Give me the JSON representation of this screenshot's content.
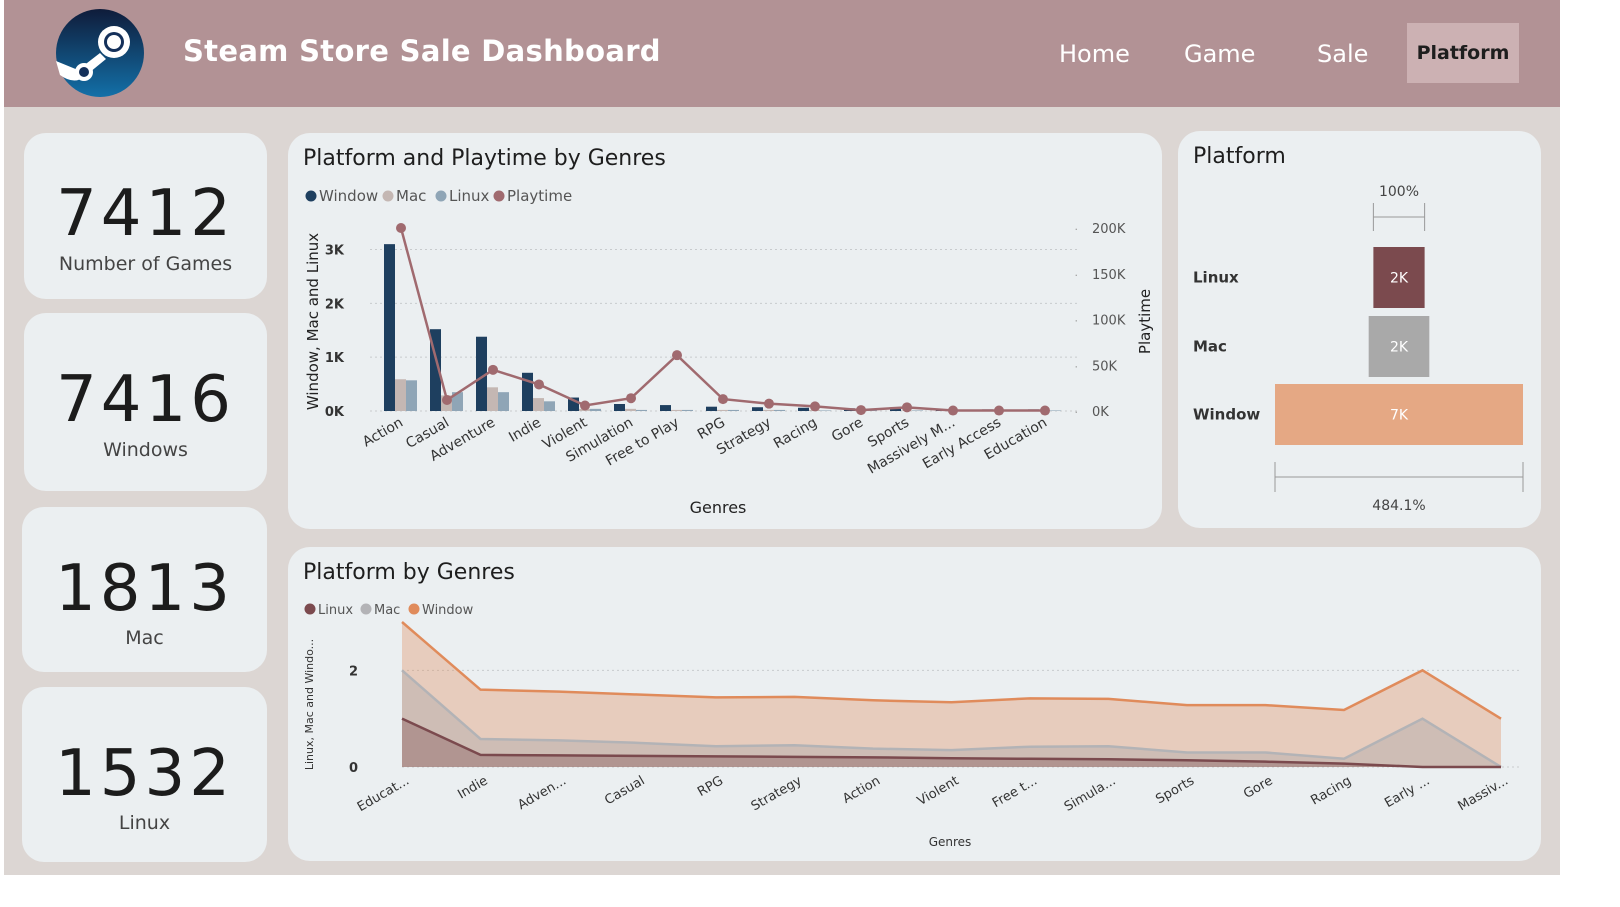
{
  "header": {
    "title": "Steam Store Sale Dashboard",
    "logo_icon": "steam-logo-icon",
    "nav": [
      {
        "label": "Home",
        "active": false
      },
      {
        "label": "Game",
        "active": false
      },
      {
        "label": "Sale",
        "active": false
      },
      {
        "label": "Platform",
        "active": true
      }
    ]
  },
  "kpis": [
    {
      "value": "7412",
      "label": "Number of Games"
    },
    {
      "value": "7416",
      "label": "Windows"
    },
    {
      "value": "1813",
      "label": "Mac"
    },
    {
      "value": "1532",
      "label": "Linux"
    }
  ],
  "colors": {
    "window_bar": "#1e3f5f",
    "mac_bar": "#c4b7b3",
    "linux_bar": "#8fa5b6",
    "playtime_line": "#a06a6f",
    "funnel_linux": "#7b4a4e",
    "funnel_mac": "#a9a9a9",
    "funnel_window": "#e5a884",
    "area_linux": "#7b4a4e",
    "area_mac": "#b3b3b6",
    "area_window": "#e08b5b"
  },
  "chart_data": [
    {
      "type": "bar",
      "title": "Platform and Playtime by Genres",
      "xlabel": "Genres",
      "ylabel": "Window, Mac and Linux",
      "y2label": "Playtime",
      "legend": [
        "Window",
        "Mac",
        "Linux",
        "Playtime"
      ],
      "legend_position": "top-left",
      "categories": [
        "Action",
        "Casual",
        "Adventure",
        "Indie",
        "Violent",
        "Simulation",
        "Free to Play",
        "RPG",
        "Strategy",
        "Racing",
        "Gore",
        "Sports",
        "Massively M...",
        "Early Access",
        "Education"
      ],
      "yticks": [
        "0K",
        "1K",
        "2K",
        "3K"
      ],
      "y2ticks": [
        "0K",
        "50K",
        "100K",
        "150K",
        "200K"
      ],
      "ylim": [
        0,
        3400
      ],
      "y2lim": [
        0,
        200000
      ],
      "series": [
        {
          "name": "Window",
          "values": [
            3100,
            1520,
            1380,
            710,
            250,
            130,
            110,
            80,
            70,
            60,
            50,
            40,
            30,
            30,
            30
          ]
        },
        {
          "name": "Mac",
          "values": [
            590,
            290,
            440,
            240,
            40,
            40,
            20,
            20,
            20,
            20,
            10,
            10,
            10,
            10,
            10
          ]
        },
        {
          "name": "Linux",
          "values": [
            570,
            350,
            350,
            180,
            40,
            20,
            20,
            20,
            20,
            10,
            10,
            10,
            10,
            10,
            10
          ]
        },
        {
          "name": "Playtime",
          "kind": "line",
          "axis": "y2",
          "values": [
            200000,
            12000,
            45000,
            29000,
            6000,
            14000,
            61000,
            13000,
            8000,
            5000,
            1000,
            4000,
            500,
            500,
            500
          ]
        }
      ],
      "grid": true
    },
    {
      "type": "funnel",
      "title": "Platform",
      "categories": [
        "Linux",
        "Mac",
        "Window"
      ],
      "values": [
        1532,
        1813,
        7416
      ],
      "value_labels": [
        "2K",
        "2K",
        "7K"
      ],
      "top_label": "100%",
      "bottom_label": "484.1%"
    },
    {
      "type": "area",
      "title": "Platform by Genres",
      "xlabel": "Genres",
      "ylabel": "Linux, Mac and Windo...",
      "legend": [
        "Linux",
        "Mac",
        "Window"
      ],
      "legend_position": "top-left",
      "categories": [
        "Educat...",
        "Indie",
        "Adven...",
        "Casual",
        "RPG",
        "Strategy",
        "Action",
        "Violent",
        "Free t...",
        "Simula...",
        "Sports",
        "Gore",
        "Racing",
        "Early ...",
        "Massiv..."
      ],
      "yticks": [
        "0",
        "2"
      ],
      "ylim": [
        0,
        3
      ],
      "series": [
        {
          "name": "Linux",
          "values": [
            1.0,
            0.25,
            0.24,
            0.23,
            0.22,
            0.21,
            0.2,
            0.18,
            0.17,
            0.16,
            0.14,
            0.11,
            0.07,
            0.0,
            0.0
          ]
        },
        {
          "name": "Mac",
          "values": [
            2.0,
            0.58,
            0.55,
            0.5,
            0.43,
            0.45,
            0.38,
            0.35,
            0.42,
            0.43,
            0.3,
            0.3,
            0.17,
            1.0,
            0.0
          ]
        },
        {
          "name": "Window",
          "values": [
            3.0,
            1.6,
            1.56,
            1.5,
            1.44,
            1.45,
            1.38,
            1.34,
            1.42,
            1.41,
            1.28,
            1.28,
            1.18,
            2.0,
            1.0
          ]
        }
      ],
      "grid": true
    }
  ]
}
